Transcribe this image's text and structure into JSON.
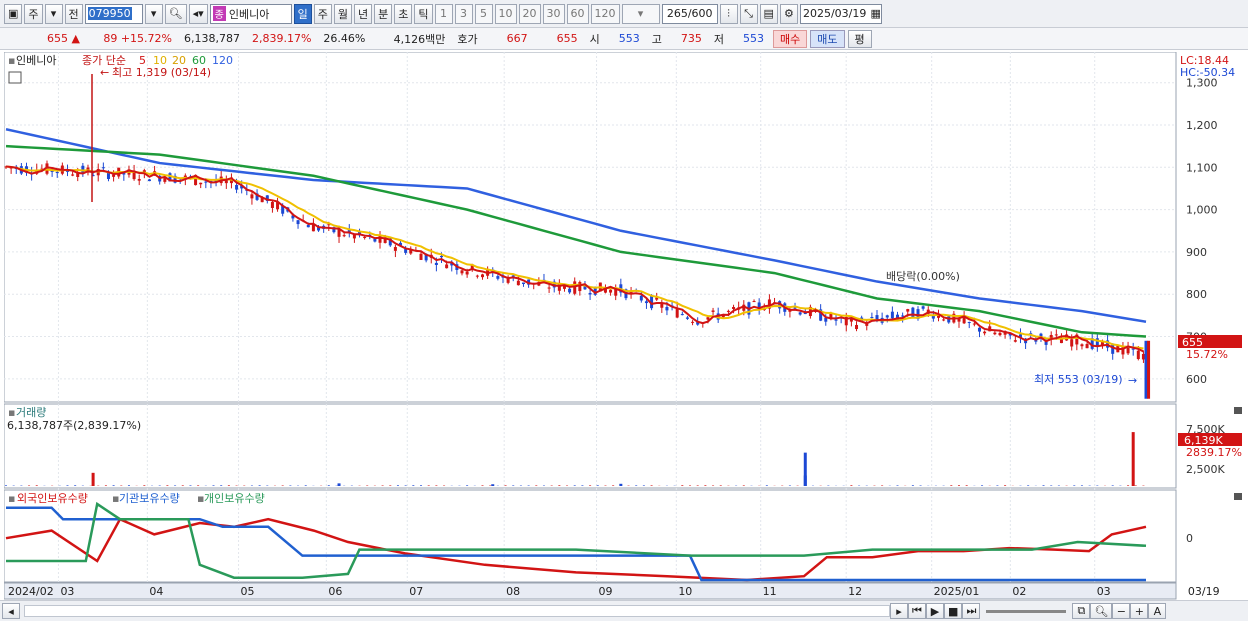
{
  "toolbar": {
    "market": "주",
    "prev": "전",
    "code": "079950",
    "name_tag": "종",
    "name": "인베니아",
    "periods": [
      "일",
      "주",
      "월",
      "년",
      "분",
      "초",
      "틱"
    ],
    "active_period": "일",
    "intervals": [
      "1",
      "3",
      "5",
      "10",
      "20",
      "30",
      "60",
      "120"
    ],
    "count": "265/600",
    "date": "2025/03/19"
  },
  "quote": {
    "price": "655",
    "change": "89",
    "change_rate": "+15.72%",
    "volume": "6,138,787",
    "volume_rate": "2,839.17%",
    "turnover": "26.46%",
    "amount": "4,126백만",
    "bid_label": "호가",
    "ask": "667",
    "bid": "655",
    "open_label": "시",
    "open": "553",
    "high_label": "고",
    "high": "735",
    "low_label": "저",
    "low": "553",
    "buy": "매수",
    "sell": "매도",
    "eval": "평"
  },
  "price_panel": {
    "name": "인베니아",
    "legend_label": "종가 단순",
    "ma": [
      {
        "period": "5",
        "color": "#d21414"
      },
      {
        "period": "10",
        "color": "#f0c000"
      },
      {
        "period": "20",
        "color": "#e8a800"
      },
      {
        "period": "60",
        "color": "#1e9a3a"
      },
      {
        "period": "120",
        "color": "#3060e0"
      }
    ],
    "lc": "LC:18.44",
    "hc": "HC:-50.34",
    "high_note": "최고 1,319 (03/14)",
    "low_note": "최저 553 (03/19)",
    "dividend_note": "배당락(0.00%)",
    "current_price": "655",
    "current_rate": "15.72%",
    "y_ticks": [
      "1,300",
      "1,200",
      "1,100",
      "1,000",
      "900",
      "800",
      "700",
      "600"
    ]
  },
  "volume_panel": {
    "title": "거래량",
    "value": "6,138,787주(2,839.17%)",
    "current": "6,139K",
    "rate": "2839.17%",
    "y_ticks": [
      "7,500K",
      "2,500K"
    ]
  },
  "holding_panel": {
    "series": [
      {
        "name": "외국인보유수량",
        "color": "#d21414"
      },
      {
        "name": "기관보유수량",
        "color": "#2060d0"
      },
      {
        "name": "개인보유수량",
        "color": "#2a9a5a"
      }
    ],
    "y_tick": "0"
  },
  "x_axis": [
    "2024/02",
    "03",
    "04",
    "05",
    "06",
    "07",
    "08",
    "09",
    "10",
    "11",
    "12",
    "2025/01",
    "02",
    "03",
    "03/19"
  ],
  "chart_data": {
    "type": "candlestick",
    "title": "인베니아",
    "x_range": [
      "2024/02",
      "2025/03/19"
    ],
    "y_range": [
      550,
      1330
    ],
    "ma_120": [
      [
        0,
        1190
      ],
      [
        60,
        1110
      ],
      [
        120,
        1070
      ],
      [
        180,
        1050
      ],
      [
        240,
        950
      ],
      [
        300,
        880
      ],
      [
        340,
        830
      ],
      [
        380,
        790
      ],
      [
        420,
        760
      ],
      [
        445,
        735
      ]
    ],
    "ma_60": [
      [
        0,
        1150
      ],
      [
        60,
        1130
      ],
      [
        120,
        1080
      ],
      [
        180,
        1000
      ],
      [
        240,
        900
      ],
      [
        300,
        850
      ],
      [
        340,
        790
      ],
      [
        380,
        760
      ],
      [
        420,
        710
      ],
      [
        445,
        700
      ]
    ],
    "close_path": [
      [
        0,
        1100
      ],
      [
        30,
        1090
      ],
      [
        60,
        1080
      ],
      [
        90,
        1060
      ],
      [
        120,
        960
      ],
      [
        150,
        920
      ],
      [
        180,
        860
      ],
      [
        210,
        820
      ],
      [
        240,
        810
      ],
      [
        270,
        740
      ],
      [
        300,
        780
      ],
      [
        330,
        730
      ],
      [
        360,
        760
      ],
      [
        390,
        700
      ],
      [
        420,
        690
      ],
      [
        445,
        655
      ]
    ],
    "volume_spikes": [
      [
        34,
        1500
      ],
      [
        130,
        300
      ],
      [
        190,
        200
      ],
      [
        240,
        250
      ],
      [
        312,
        1200
      ],
      [
        440,
        6139
      ]
    ]
  }
}
